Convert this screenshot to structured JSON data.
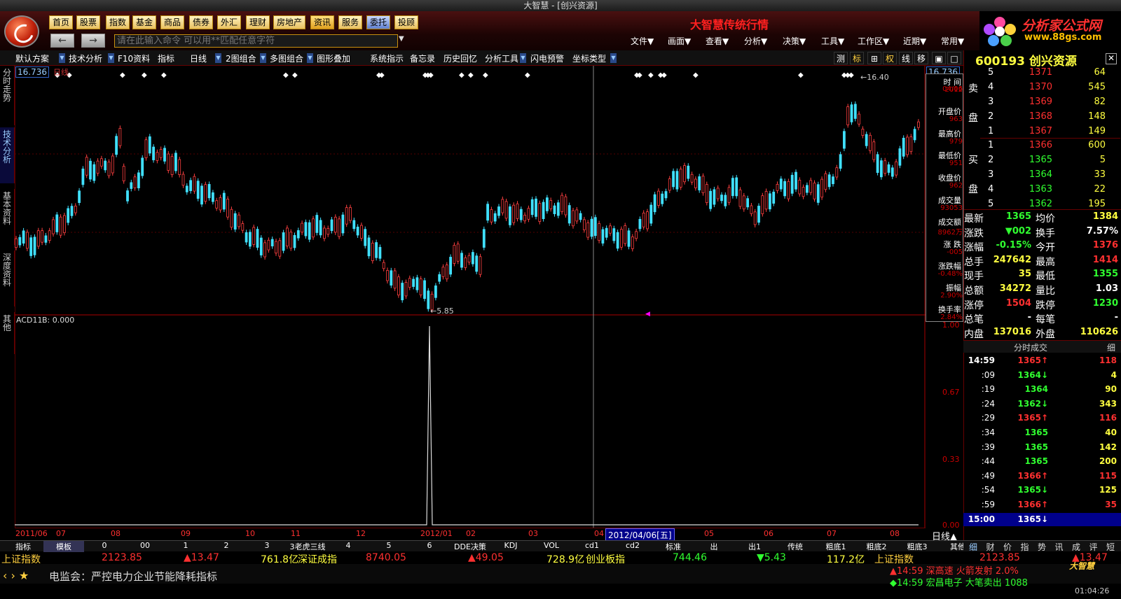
{
  "window": {
    "title": "大智慧 - [创兴资源]"
  },
  "nav": [
    "首页",
    "股票",
    "指数",
    "基金",
    "商品",
    "债券",
    "外汇",
    "理财",
    "房地产",
    "资讯",
    "服务",
    "委托",
    "投顾"
  ],
  "command": {
    "placeholder": "请在此输入命令    可以用**匹配任意字符"
  },
  "headline": "大智慧传统行情",
  "menus": [
    "文件▼",
    "画面▼",
    "查看▼",
    "分析▼",
    "决策▼",
    "工具▼",
    "工作区▼",
    "近期▼",
    "常用▼"
  ],
  "brand": {
    "name": "分析家公式网",
    "url": "www.88gs.com"
  },
  "toolbar": [
    "默认方案",
    "技术分析",
    "F10资料",
    "指标",
    "日线",
    "2图组合",
    "多图组合",
    "图形叠加",
    "系统指示",
    "备忘录",
    "历史回忆",
    "分析工具",
    "闪电预警",
    "坐标类型"
  ],
  "toolbar_right": [
    "测",
    "标",
    "⊞",
    "权",
    "线",
    "移"
  ],
  "side_tabs": [
    "分时走势",
    "技术分析",
    "基本资料",
    "深度资料",
    "其他"
  ],
  "chart_labels": {
    "period": "日线",
    "price_top": "16.736",
    "price_top_right": "16.736",
    "high_mark": "16.40",
    "low_mark": "5.85",
    "indicator": "ACD11",
    "indicator_value": "B: 0.000",
    "axis_right": [
      "1.00",
      "0.67",
      "0.33",
      "0.00"
    ],
    "cursor_date": "2012/04/06[五]",
    "period_btn": "日线▲"
  },
  "chart_data": {
    "type": "candlestick",
    "xlabel_ticks": [
      "2011/06",
      "07",
      "08",
      "09",
      "10",
      "11",
      "12",
      "2012/01",
      "02",
      "03",
      "04",
      "05",
      "06",
      "07",
      "08",
      "09"
    ],
    "indicator_series": {
      "name": "ACD11",
      "spike_at_tick": "2012/01",
      "max": 1.0
    }
  },
  "info_box": [
    {
      "label": "时 间",
      "value": "2012"
    },
    {
      "label": "",
      "value": "04/06"
    },
    {
      "label": "开盘价",
      "value": "963"
    },
    {
      "label": "最高价",
      "value": "979"
    },
    {
      "label": "最低价",
      "value": "951"
    },
    {
      "label": "收盘价",
      "value": "962"
    },
    {
      "label": "成交量",
      "value": "93053"
    },
    {
      "label": "成交额",
      "value": "8962万"
    },
    {
      "label": "涨 跌",
      "value": "-005"
    },
    {
      "label": "涨跌幅",
      "value": "-0.48%"
    },
    {
      "label": "振幅",
      "value": "2.90%"
    },
    {
      "label": "换手率",
      "value": "2.84%"
    }
  ],
  "quote": {
    "code_name": "600193 创兴资源",
    "sell_label": [
      "卖",
      "盘"
    ],
    "buy_label": [
      "买",
      "盘"
    ],
    "sells": [
      [
        "5",
        "1371",
        "64"
      ],
      [
        "4",
        "1370",
        "545"
      ],
      [
        "3",
        "1369",
        "82"
      ],
      [
        "2",
        "1368",
        "148"
      ],
      [
        "1",
        "1367",
        "149"
      ]
    ],
    "buys": [
      [
        "1",
        "1366",
        "600"
      ],
      [
        "2",
        "1365",
        "5"
      ],
      [
        "3",
        "1364",
        "33"
      ],
      [
        "4",
        "1363",
        "22"
      ],
      [
        "5",
        "1362",
        "195"
      ]
    ],
    "stats": [
      [
        "最新",
        "1365",
        "均价",
        "1384"
      ],
      [
        "涨跌",
        "▼002",
        "换手",
        "7.57%"
      ],
      [
        "涨幅",
        "-0.15%",
        "今开",
        "1376"
      ],
      [
        "总手",
        "247642",
        "最高",
        "1414"
      ],
      [
        "现手",
        "35",
        "最低",
        "1355"
      ],
      [
        "总额",
        "34272",
        "量比",
        "1.03"
      ],
      [
        "涨停",
        "1504",
        "跌停",
        "1230"
      ],
      [
        "总笔",
        "-",
        "每笔",
        "-"
      ],
      [
        "内盘",
        "137016",
        "外盘",
        "110626"
      ]
    ],
    "trades_header": "分时成交",
    "trades_tab": "细",
    "trades": [
      [
        "14:59",
        "1365↑",
        "118"
      ],
      [
        ":09",
        "1364↓",
        "4"
      ],
      [
        ":19",
        "1364",
        "90"
      ],
      [
        ":24",
        "1362↓",
        "343"
      ],
      [
        ":29",
        "1365↑",
        "116"
      ],
      [
        ":34",
        "1365",
        "40"
      ],
      [
        ":39",
        "1365",
        "142"
      ],
      [
        ":44",
        "1365",
        "200"
      ],
      [
        ":49",
        "1366↑",
        "115"
      ],
      [
        ":54",
        "1365↓",
        "125"
      ],
      [
        ":59",
        "1366↑",
        "35"
      ],
      [
        "15:00",
        "1365↓",
        ""
      ]
    ],
    "bottom_tabs": [
      "细",
      "财",
      "价",
      "指",
      "势",
      "讯",
      "成",
      "评",
      "短"
    ]
  },
  "bottom_tabs": [
    "指标",
    "模板",
    "0",
    "00",
    "1",
    "2",
    "3",
    "3老虎三线",
    "4",
    "5",
    "6",
    "DDE决策",
    "KDJ",
    "VOL",
    "cd1",
    "cd2",
    "标准",
    "出",
    "出1",
    "传统",
    "粗底1",
    "粗底2",
    "粗底3",
    "其他"
  ],
  "index_bar": [
    "上证指数",
    "2123.85",
    "▲13.47",
    "761.8亿",
    "深证成指",
    "8740.05",
    "▲49.05",
    "728.9亿",
    "创业板指",
    "744.46",
    "▼5.43",
    "117.2亿",
    "上证指数",
    "2123.85",
    "▲13.47"
  ],
  "scroll_text": "电监会：严控电力企业节能降耗指标",
  "alerts": [
    "14:59 深高速  火箭发射 2.0%",
    "14:59 宏昌电子  大笔卖出 1088"
  ],
  "clock": "01:04:26",
  "dzh_badge": "大智慧"
}
